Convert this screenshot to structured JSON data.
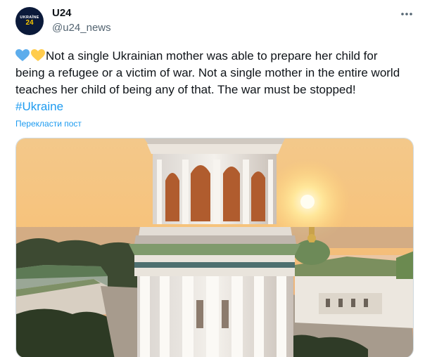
{
  "account": {
    "avatar_line1": "UKRAÏNE",
    "avatar_line2": "24",
    "display_name": "U24",
    "handle": "@u24_news"
  },
  "menu_icon": "more-horizontal-icon",
  "post": {
    "emoji": [
      "blue-heart-icon",
      "yellow-heart-icon"
    ],
    "text": "Not a single Ukrainian mother was able to prepare her child for being a refugee or a victim of war. Not a single mother in the entire world teaches her child of being any of that. The war must be stopped!",
    "hashtag": "#Ukraine",
    "translate_label": "Перекласти пост"
  },
  "media": {
    "description_icon": "bell-tower-photo"
  },
  "colors": {
    "link": "#1d9bf0",
    "text": "#0f1419",
    "secondary": "#536471",
    "heart_blue": "#5dadec",
    "heart_yellow": "#ffcc4d"
  }
}
